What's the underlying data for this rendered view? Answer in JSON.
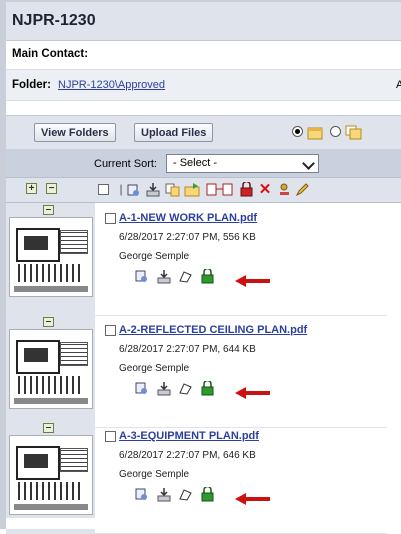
{
  "header": {
    "title": "NJPR-1230"
  },
  "contact": {
    "label": "Main Contact:"
  },
  "folder": {
    "label": "Folder:",
    "value": "NJPR-1230\\Approved",
    "truncated_right": "A"
  },
  "toolbar": {
    "view_folders_label": "View Folders",
    "upload_files_label": "Upload Files",
    "view_mode_selected": "list"
  },
  "sort": {
    "label": "Current Sort:",
    "selected": "- Select -"
  },
  "files": [
    {
      "name": "A-1-NEW WORK PLAN.pdf",
      "meta": "6/28/2017 2:27:07 PM, 556 KB",
      "author": "George Semple"
    },
    {
      "name": "A-2-REFLECTED CEILING PLAN.pdf",
      "meta": "6/28/2017 2:27:07 PM, 644 KB",
      "author": "George Semple"
    },
    {
      "name": "A-3-EQUIPMENT PLAN.pdf",
      "meta": "6/28/2017 2:27:07 PM, 646 KB",
      "author": "George Semple"
    }
  ],
  "colors": {
    "accent_link": "#2d3f9e",
    "arrow_red": "#cc1111",
    "panel_bg": "#dfe4ec"
  }
}
